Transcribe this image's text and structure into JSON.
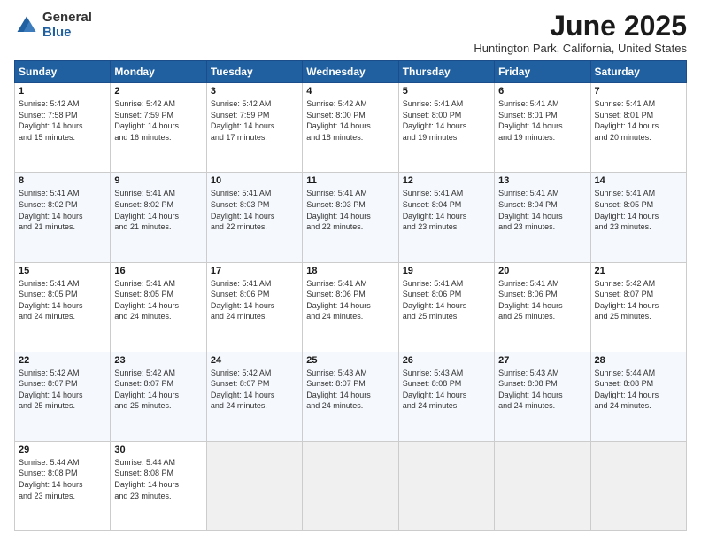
{
  "logo": {
    "general": "General",
    "blue": "Blue"
  },
  "title": {
    "month": "June 2025",
    "location": "Huntington Park, California, United States"
  },
  "calendar": {
    "headers": [
      "Sunday",
      "Monday",
      "Tuesday",
      "Wednesday",
      "Thursday",
      "Friday",
      "Saturday"
    ],
    "rows": [
      [
        {
          "day": "1",
          "lines": [
            "Sunrise: 5:42 AM",
            "Sunset: 7:58 PM",
            "Daylight: 14 hours",
            "and 15 minutes."
          ]
        },
        {
          "day": "2",
          "lines": [
            "Sunrise: 5:42 AM",
            "Sunset: 7:59 PM",
            "Daylight: 14 hours",
            "and 16 minutes."
          ]
        },
        {
          "day": "3",
          "lines": [
            "Sunrise: 5:42 AM",
            "Sunset: 7:59 PM",
            "Daylight: 14 hours",
            "and 17 minutes."
          ]
        },
        {
          "day": "4",
          "lines": [
            "Sunrise: 5:42 AM",
            "Sunset: 8:00 PM",
            "Daylight: 14 hours",
            "and 18 minutes."
          ]
        },
        {
          "day": "5",
          "lines": [
            "Sunrise: 5:41 AM",
            "Sunset: 8:00 PM",
            "Daylight: 14 hours",
            "and 19 minutes."
          ]
        },
        {
          "day": "6",
          "lines": [
            "Sunrise: 5:41 AM",
            "Sunset: 8:01 PM",
            "Daylight: 14 hours",
            "and 19 minutes."
          ]
        },
        {
          "day": "7",
          "lines": [
            "Sunrise: 5:41 AM",
            "Sunset: 8:01 PM",
            "Daylight: 14 hours",
            "and 20 minutes."
          ]
        }
      ],
      [
        {
          "day": "8",
          "lines": [
            "Sunrise: 5:41 AM",
            "Sunset: 8:02 PM",
            "Daylight: 14 hours",
            "and 21 minutes."
          ]
        },
        {
          "day": "9",
          "lines": [
            "Sunrise: 5:41 AM",
            "Sunset: 8:02 PM",
            "Daylight: 14 hours",
            "and 21 minutes."
          ]
        },
        {
          "day": "10",
          "lines": [
            "Sunrise: 5:41 AM",
            "Sunset: 8:03 PM",
            "Daylight: 14 hours",
            "and 22 minutes."
          ]
        },
        {
          "day": "11",
          "lines": [
            "Sunrise: 5:41 AM",
            "Sunset: 8:03 PM",
            "Daylight: 14 hours",
            "and 22 minutes."
          ]
        },
        {
          "day": "12",
          "lines": [
            "Sunrise: 5:41 AM",
            "Sunset: 8:04 PM",
            "Daylight: 14 hours",
            "and 23 minutes."
          ]
        },
        {
          "day": "13",
          "lines": [
            "Sunrise: 5:41 AM",
            "Sunset: 8:04 PM",
            "Daylight: 14 hours",
            "and 23 minutes."
          ]
        },
        {
          "day": "14",
          "lines": [
            "Sunrise: 5:41 AM",
            "Sunset: 8:05 PM",
            "Daylight: 14 hours",
            "and 23 minutes."
          ]
        }
      ],
      [
        {
          "day": "15",
          "lines": [
            "Sunrise: 5:41 AM",
            "Sunset: 8:05 PM",
            "Daylight: 14 hours",
            "and 24 minutes."
          ]
        },
        {
          "day": "16",
          "lines": [
            "Sunrise: 5:41 AM",
            "Sunset: 8:05 PM",
            "Daylight: 14 hours",
            "and 24 minutes."
          ]
        },
        {
          "day": "17",
          "lines": [
            "Sunrise: 5:41 AM",
            "Sunset: 8:06 PM",
            "Daylight: 14 hours",
            "and 24 minutes."
          ]
        },
        {
          "day": "18",
          "lines": [
            "Sunrise: 5:41 AM",
            "Sunset: 8:06 PM",
            "Daylight: 14 hours",
            "and 24 minutes."
          ]
        },
        {
          "day": "19",
          "lines": [
            "Sunrise: 5:41 AM",
            "Sunset: 8:06 PM",
            "Daylight: 14 hours",
            "and 25 minutes."
          ]
        },
        {
          "day": "20",
          "lines": [
            "Sunrise: 5:41 AM",
            "Sunset: 8:06 PM",
            "Daylight: 14 hours",
            "and 25 minutes."
          ]
        },
        {
          "day": "21",
          "lines": [
            "Sunrise: 5:42 AM",
            "Sunset: 8:07 PM",
            "Daylight: 14 hours",
            "and 25 minutes."
          ]
        }
      ],
      [
        {
          "day": "22",
          "lines": [
            "Sunrise: 5:42 AM",
            "Sunset: 8:07 PM",
            "Daylight: 14 hours",
            "and 25 minutes."
          ]
        },
        {
          "day": "23",
          "lines": [
            "Sunrise: 5:42 AM",
            "Sunset: 8:07 PM",
            "Daylight: 14 hours",
            "and 25 minutes."
          ]
        },
        {
          "day": "24",
          "lines": [
            "Sunrise: 5:42 AM",
            "Sunset: 8:07 PM",
            "Daylight: 14 hours",
            "and 24 minutes."
          ]
        },
        {
          "day": "25",
          "lines": [
            "Sunrise: 5:43 AM",
            "Sunset: 8:07 PM",
            "Daylight: 14 hours",
            "and 24 minutes."
          ]
        },
        {
          "day": "26",
          "lines": [
            "Sunrise: 5:43 AM",
            "Sunset: 8:08 PM",
            "Daylight: 14 hours",
            "and 24 minutes."
          ]
        },
        {
          "day": "27",
          "lines": [
            "Sunrise: 5:43 AM",
            "Sunset: 8:08 PM",
            "Daylight: 14 hours",
            "and 24 minutes."
          ]
        },
        {
          "day": "28",
          "lines": [
            "Sunrise: 5:44 AM",
            "Sunset: 8:08 PM",
            "Daylight: 14 hours",
            "and 24 minutes."
          ]
        }
      ],
      [
        {
          "day": "29",
          "lines": [
            "Sunrise: 5:44 AM",
            "Sunset: 8:08 PM",
            "Daylight: 14 hours",
            "and 23 minutes."
          ]
        },
        {
          "day": "30",
          "lines": [
            "Sunrise: 5:44 AM",
            "Sunset: 8:08 PM",
            "Daylight: 14 hours",
            "and 23 minutes."
          ]
        },
        {
          "day": "",
          "lines": []
        },
        {
          "day": "",
          "lines": []
        },
        {
          "day": "",
          "lines": []
        },
        {
          "day": "",
          "lines": []
        },
        {
          "day": "",
          "lines": []
        }
      ]
    ]
  }
}
